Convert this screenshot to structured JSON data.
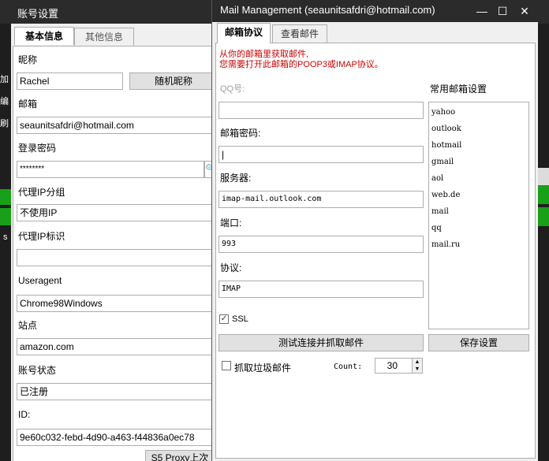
{
  "account": {
    "title": "账号设置",
    "tabs": [
      "基本信息",
      "其他信息"
    ],
    "nickname_label": "昵称",
    "nickname": "Rachel",
    "random_nick_btn": "随机昵称",
    "email_label": "邮箱",
    "email": "seaunitsafdri@hotmail.com",
    "password_label": "登录密码",
    "password": "********",
    "proxy_group_label": "代理IP分组",
    "proxy_group": "不使用IP",
    "proxy_tag_label": "代理IP标识",
    "proxy_tag": "",
    "ua_label": "Useragent",
    "ua": "Chrome98Windows",
    "site_label": "站点",
    "site": "amazon.com",
    "status_label": "账号状态",
    "status": "已注册",
    "id_label": "ID:",
    "id": "9e60c032-febd-4d90-a463-f44836a0ec78",
    "s5_btn": "S5 Proxy上次"
  },
  "background_glyphs": [
    "账",
    "加",
    "编",
    "刷",
    "s",
    "s",
    "s"
  ],
  "mail": {
    "title": "Mail Management  (seaunitsafdri@hotmail.com)",
    "controls": [
      "—",
      "☐",
      "✕"
    ],
    "tabs": [
      "邮箱协议",
      "查看邮件"
    ],
    "notice_line1": "从你的邮箱里获取邮件,",
    "notice_line2": "您需要打开此邮箱的POOP3或IMAP协议。",
    "qq_label": "QQ号:",
    "qq_value": "",
    "pwd_label": "邮箱密码:",
    "pwd_value": "|",
    "server_label": "服务器:",
    "server_value": "imap-mail.outlook.com",
    "port_label": "端口:",
    "port_value": "993",
    "protocol_label": "协议:",
    "protocol_value": "IMAP",
    "ssl_label": "SSL",
    "ssl_checked": true,
    "test_btn": "测试连接并抓取邮件",
    "junk_label": "抓取垃圾邮件",
    "junk_checked": false,
    "count_label": "Count:",
    "count_value": "30",
    "common_label": "常用邮箱设置",
    "common_list": [
      "yahoo",
      "outlook",
      "hotmail",
      "gmail",
      "aol",
      "web.de",
      "mail",
      "qq",
      "mail.ru"
    ],
    "save_btn": "保存设置"
  },
  "colors": {
    "title_bar": "#2b2b2b",
    "notice": "#cc0000",
    "green_rows": "#18a018"
  }
}
